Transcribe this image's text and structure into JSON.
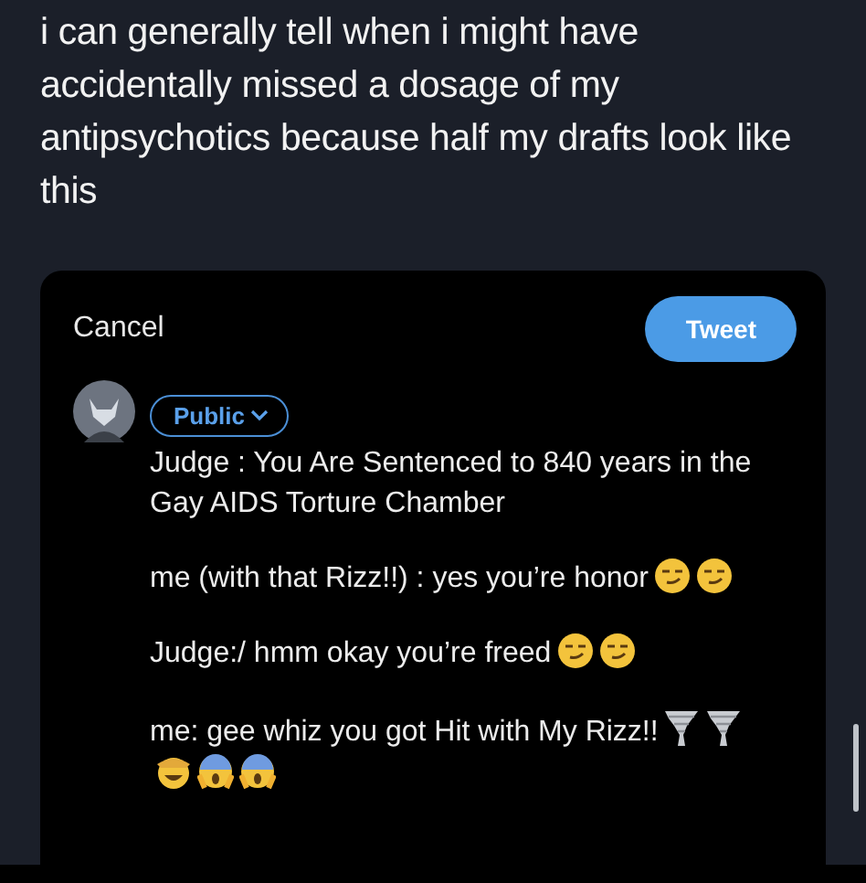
{
  "caption": "i can generally tell when i might have accidentally missed a dosage of my antipsychotics because half my drafts look like this",
  "composer": {
    "cancel": "Cancel",
    "tweet": "Tweet",
    "audience": "Public",
    "paragraphs": [
      {
        "text": "Judge : You Are Sentenced to 840 years in the Gay AIDS Torture Chamber"
      },
      {
        "text": "me (with that Rizz!!) : yes you’re honor",
        "emojis": [
          {
            "kind": "smirk"
          },
          {
            "kind": "smirk"
          }
        ]
      },
      {
        "text": "Judge:/ hmm okay you’re freed",
        "emojis": [
          {
            "kind": "smirk"
          },
          {
            "kind": "smirk"
          }
        ]
      },
      {
        "text": "me: gee whiz you got Hit with My Rizz!!",
        "emojis": [
          {
            "kind": "tornado"
          },
          {
            "kind": "tornado"
          },
          {
            "kind": "hat"
          },
          {
            "kind": "scream"
          },
          {
            "kind": "scream"
          }
        ]
      }
    ]
  }
}
